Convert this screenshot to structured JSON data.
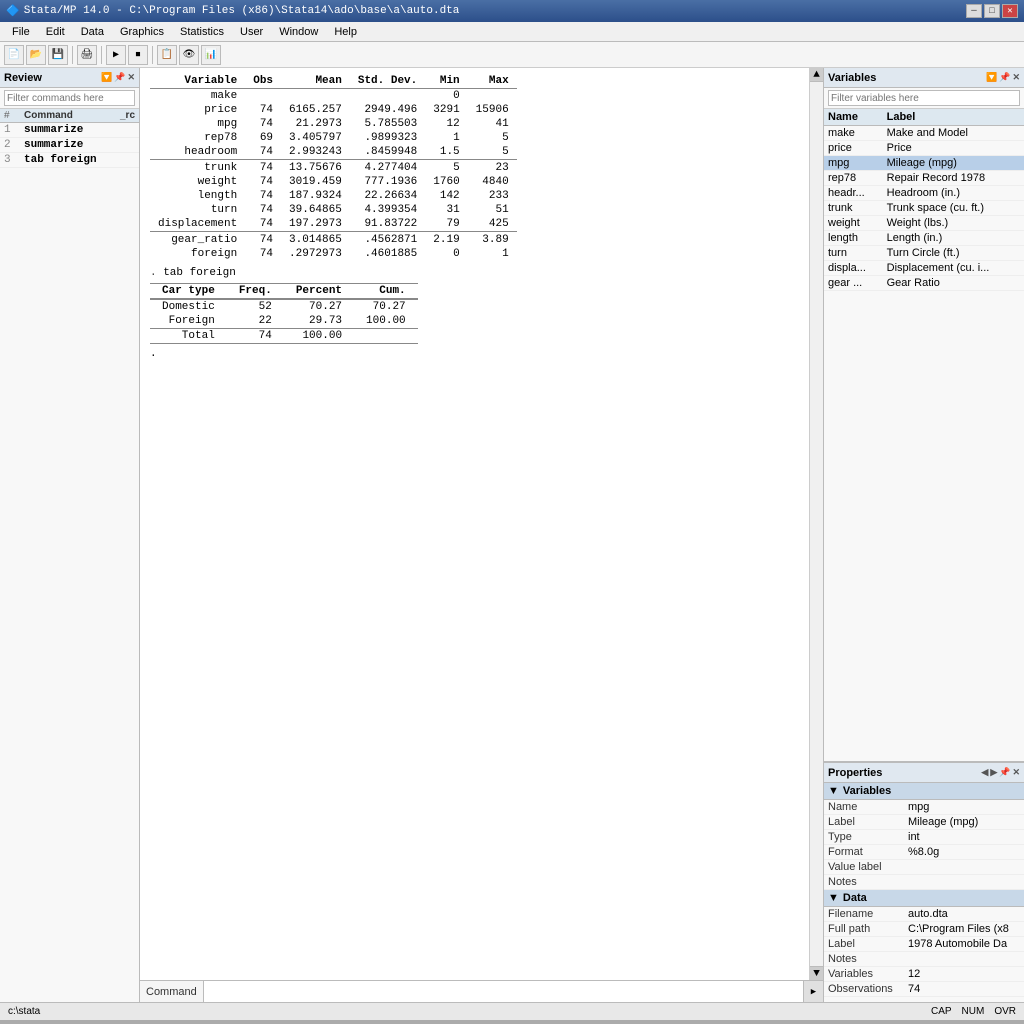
{
  "titlebar": {
    "title": "Stata/MP 14.0 - C:\\Program Files (x86)\\Stata14\\ado\\base\\a\\auto.dta",
    "minimize": "─",
    "maximize": "□",
    "close": "✕"
  },
  "menubar": {
    "items": [
      "File",
      "Edit",
      "Data",
      "Graphics",
      "Statistics",
      "User",
      "Window",
      "Help"
    ]
  },
  "panels": {
    "review": "Review",
    "variables": "Variables",
    "properties": "Properties"
  },
  "review": {
    "search_placeholder": "Filter commands here",
    "col_num": "#",
    "col_command": "Command",
    "col_rc": "_rc",
    "commands": [
      {
        "num": "1",
        "cmd": "summarize",
        "rc": ""
      },
      {
        "num": "2",
        "cmd": "summarize",
        "rc": ""
      },
      {
        "num": "3",
        "cmd": "tab foreign",
        "rc": ""
      }
    ]
  },
  "summarize_table": {
    "headers": [
      "Variable",
      "Obs",
      "Mean",
      "Std. Dev.",
      "Min",
      "Max"
    ],
    "rows": [
      {
        "var": "make",
        "obs": "",
        "mean": "",
        "sd": "",
        "min": "0",
        "max": ""
      },
      {
        "var": "price",
        "obs": "74",
        "mean": "6165.257",
        "sd": "2949.496",
        "min": "3291",
        "max": "15906"
      },
      {
        "var": "mpg",
        "obs": "74",
        "mean": "21.2973",
        "sd": "5.785503",
        "min": "12",
        "max": "41"
      },
      {
        "var": "rep78",
        "obs": "69",
        "mean": "3.405797",
        "sd": ".9899323",
        "min": "1",
        "max": "5"
      },
      {
        "var": "headroom",
        "obs": "74",
        "mean": "2.993243",
        "sd": ".8459948",
        "min": "1.5",
        "max": "5"
      },
      {
        "var": "trunk",
        "obs": "74",
        "mean": "13.75676",
        "sd": "4.277404",
        "min": "5",
        "max": "23"
      },
      {
        "var": "weight",
        "obs": "74",
        "mean": "3019.459",
        "sd": "777.1936",
        "min": "1760",
        "max": "4840"
      },
      {
        "var": "length",
        "obs": "74",
        "mean": "187.9324",
        "sd": "22.26634",
        "min": "142",
        "max": "233"
      },
      {
        "var": "turn",
        "obs": "74",
        "mean": "39.64865",
        "sd": "4.399354",
        "min": "31",
        "max": "51"
      },
      {
        "var": "displacement",
        "obs": "74",
        "mean": "197.2973",
        "sd": "91.83722",
        "min": "79",
        "max": "425"
      },
      {
        "var": "gear_ratio",
        "obs": "74",
        "mean": "3.014865",
        "sd": ".4562871",
        "min": "2.19",
        "max": "3.89"
      },
      {
        "var": "foreign",
        "obs": "74",
        "mean": ".2972973",
        "sd": ".4601885",
        "min": "0",
        "max": "1"
      }
    ]
  },
  "tab_cmd": "tab foreign",
  "tab_table": {
    "col1": "Car type",
    "col2": "Freq.",
    "col3": "Percent",
    "col4": "Cum.",
    "rows": [
      {
        "type": "Domestic",
        "freq": "52",
        "pct": "70.27",
        "cum": "70.27"
      },
      {
        "type": "Foreign",
        "freq": "22",
        "pct": "29.73",
        "cum": "100.00"
      }
    ],
    "total": {
      "type": "Total",
      "freq": "74",
      "pct": "100.00",
      "cum": ""
    }
  },
  "command_bar": {
    "label": "Command",
    "value": "",
    "placeholder": ""
  },
  "variables": {
    "search_placeholder": "Filter variables here",
    "col_name": "Name",
    "col_label": "Label",
    "rows": [
      {
        "name": "make",
        "label": "Make and Model",
        "selected": false
      },
      {
        "name": "price",
        "label": "Price",
        "selected": false
      },
      {
        "name": "mpg",
        "label": "Mileage (mpg)",
        "selected": true
      },
      {
        "name": "rep78",
        "label": "Repair Record 1978",
        "selected": false
      },
      {
        "name": "headr...",
        "label": "Headroom (in.)",
        "selected": false
      },
      {
        "name": "trunk",
        "label": "Trunk space (cu. ft.)",
        "selected": false
      },
      {
        "name": "weight",
        "label": "Weight (lbs.)",
        "selected": false
      },
      {
        "name": "length",
        "label": "Length (in.)",
        "selected": false
      },
      {
        "name": "turn",
        "label": "Turn Circle (ft.)",
        "selected": false
      },
      {
        "name": "displa...",
        "label": "Displacement (cu. i...",
        "selected": false
      },
      {
        "name": "gear ...",
        "label": "Gear Ratio",
        "selected": false
      }
    ]
  },
  "properties": {
    "variables_section": "Variables",
    "props": [
      {
        "key": "Name",
        "val": "mpg"
      },
      {
        "key": "Label",
        "val": "Mileage (mpg)"
      },
      {
        "key": "Type",
        "val": "int"
      },
      {
        "key": "Format",
        "val": "%8.0g"
      },
      {
        "key": "Value label",
        "val": ""
      },
      {
        "key": "Notes",
        "val": ""
      }
    ],
    "data_section": "Data",
    "data_props": [
      {
        "key": "Filename",
        "val": "auto.dta"
      },
      {
        "key": "Full path",
        "val": "C:\\Program Files (x8"
      },
      {
        "key": "Label",
        "val": "1978 Automobile Da"
      },
      {
        "key": "Notes",
        "val": ""
      },
      {
        "key": "Variables",
        "val": "12"
      },
      {
        "key": "Observations",
        "val": "74"
      }
    ]
  },
  "status": {
    "path": "c:\\stata",
    "cap": "CAP",
    "num": "NUM",
    "ovr": "OVR"
  }
}
